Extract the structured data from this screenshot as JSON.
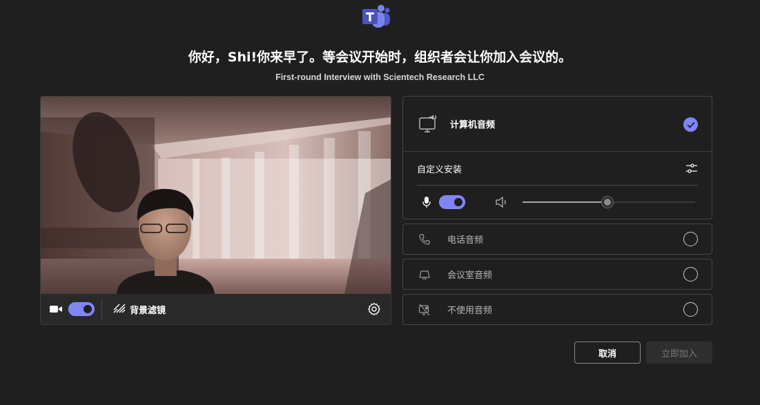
{
  "header": {
    "app_icon": "microsoft-teams-logo",
    "greeting": "你好，Shi!你来早了。等会议开始时，组织者会让你加入会议的。",
    "meeting_title": "First-round Interview with Scientech Research LLC"
  },
  "video": {
    "camera_icon": "video-camera-icon",
    "camera_on": true,
    "background_filter_icon": "background-effects-icon",
    "background_filter_label": "背景滤镜",
    "settings_icon": "gear-icon"
  },
  "audio": {
    "computer_audio": {
      "icon": "computer-speaker-icon",
      "label": "计算机音频",
      "selected": true
    },
    "custom_setup_label": "自定义安装",
    "custom_setup_icon": "sliders-icon",
    "mic_icon": "microphone-icon",
    "mic_on": true,
    "speaker_icon": "speaker-icon",
    "speaker_volume_fraction": 0.49,
    "options": [
      {
        "icon": "phone-icon",
        "label": "电话音频"
      },
      {
        "icon": "room-audio-icon",
        "label": "会议室音频"
      },
      {
        "icon": "no-audio-icon",
        "label": "不使用音频"
      }
    ]
  },
  "actions": {
    "cancel_label": "取消",
    "join_label": "立即加入"
  },
  "colors": {
    "background": "#1f1f1f",
    "accent": "#7f85f5",
    "teams_purple": "#5b5fc7"
  }
}
